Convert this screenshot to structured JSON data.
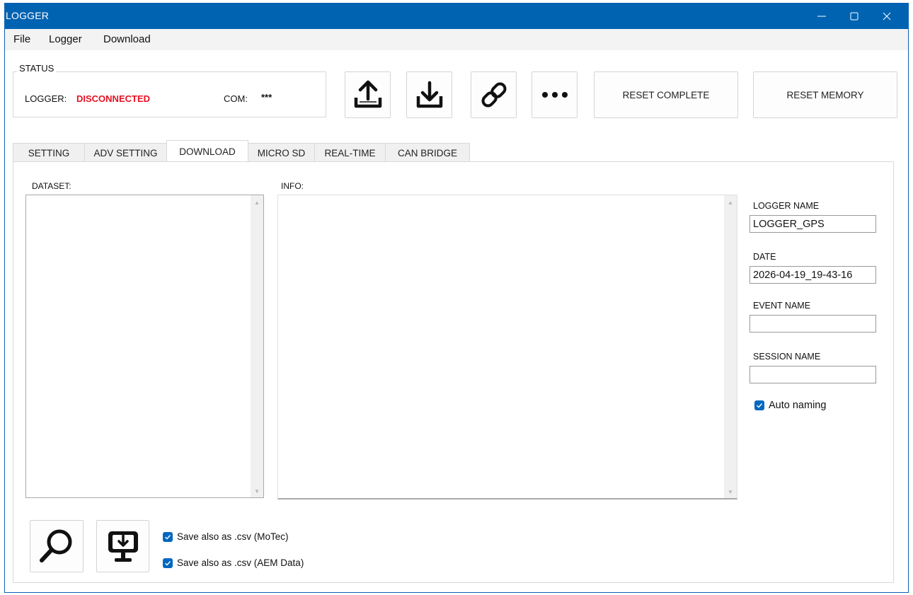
{
  "window": {
    "title": "LOGGER"
  },
  "menu": [
    "File",
    "Logger",
    "Download"
  ],
  "status": {
    "legend": "STATUS",
    "logger_label": "LOGGER:",
    "logger_value": "DISCONNECTED",
    "com_label": "COM:",
    "com_value": "***",
    "disconnected_color": "#e81123"
  },
  "toolbar": {
    "reset_complete": "RESET COMPLETE",
    "reset_memory": "RESET MEMORY",
    "icons": [
      "upload-icon",
      "download-icon",
      "link-icon",
      "more-icon"
    ]
  },
  "tabs": [
    "SETTING",
    "ADV SETTING",
    "DOWNLOAD",
    "MICRO SD",
    "REAL-TIME",
    "CAN BRIDGE"
  ],
  "active_tab": "DOWNLOAD",
  "download": {
    "dataset_label": "DATASET:",
    "info_label": "INFO:",
    "logger_name_label": "LOGGER NAME",
    "logger_name_value": "LOGGER_GPS",
    "date_label": "DATE",
    "date_value": "2026-04-19_19-43-16",
    "event_name_label": "EVENT NAME",
    "event_name_value": "",
    "session_name_label": "SESSION NAME",
    "session_name_value": "",
    "auto_naming_label": "Auto naming",
    "auto_naming_checked": true,
    "csv_motec_label": "Save also as .csv (MoTec)",
    "csv_motec_checked": true,
    "csv_aem_label": "Save also as .csv (AEM Data)",
    "csv_aem_checked": true
  },
  "colors": {
    "titlebar": "#0063b1",
    "checkbox": "#0067c0"
  }
}
